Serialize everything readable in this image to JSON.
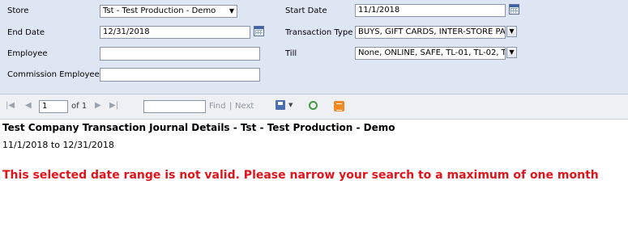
{
  "params": {
    "store": {
      "label": "Store",
      "value": "Tst - Test Production - Demo"
    },
    "start_date": {
      "label": "Start Date",
      "value": "11/1/2018"
    },
    "end_date": {
      "label": "End Date",
      "value": "12/31/2018"
    },
    "transaction_type": {
      "label": "Transaction Type",
      "value": "BUYS, GIFT CARDS, INTER-STORE PA"
    },
    "employee": {
      "label": "Employee",
      "value": ""
    },
    "till": {
      "label": "Till",
      "value": "None, ONLINE, SAFE, TL-01, TL-02, T"
    },
    "commission_employee": {
      "label": "Commission Employee",
      "value": ""
    }
  },
  "toolbar": {
    "page_value": "1",
    "page_of": "of 1",
    "find_label": "Find",
    "separator": "|",
    "next_label": "Next",
    "icons": [
      "first-page-icon",
      "prev-page-icon",
      "next-page-icon",
      "last-page-icon",
      "export-icon",
      "refresh-icon",
      "print-icon"
    ]
  },
  "report": {
    "title": "Test Company Transaction Journal Details - Tst - Test Production - Demo",
    "date_range": "11/1/2018 to 12/31/2018",
    "error": "This selected date range is not valid.  Please narrow your search to a maximum of one month"
  },
  "colors": {
    "error": "#e0141b",
    "panel": "#dfe6f3"
  }
}
